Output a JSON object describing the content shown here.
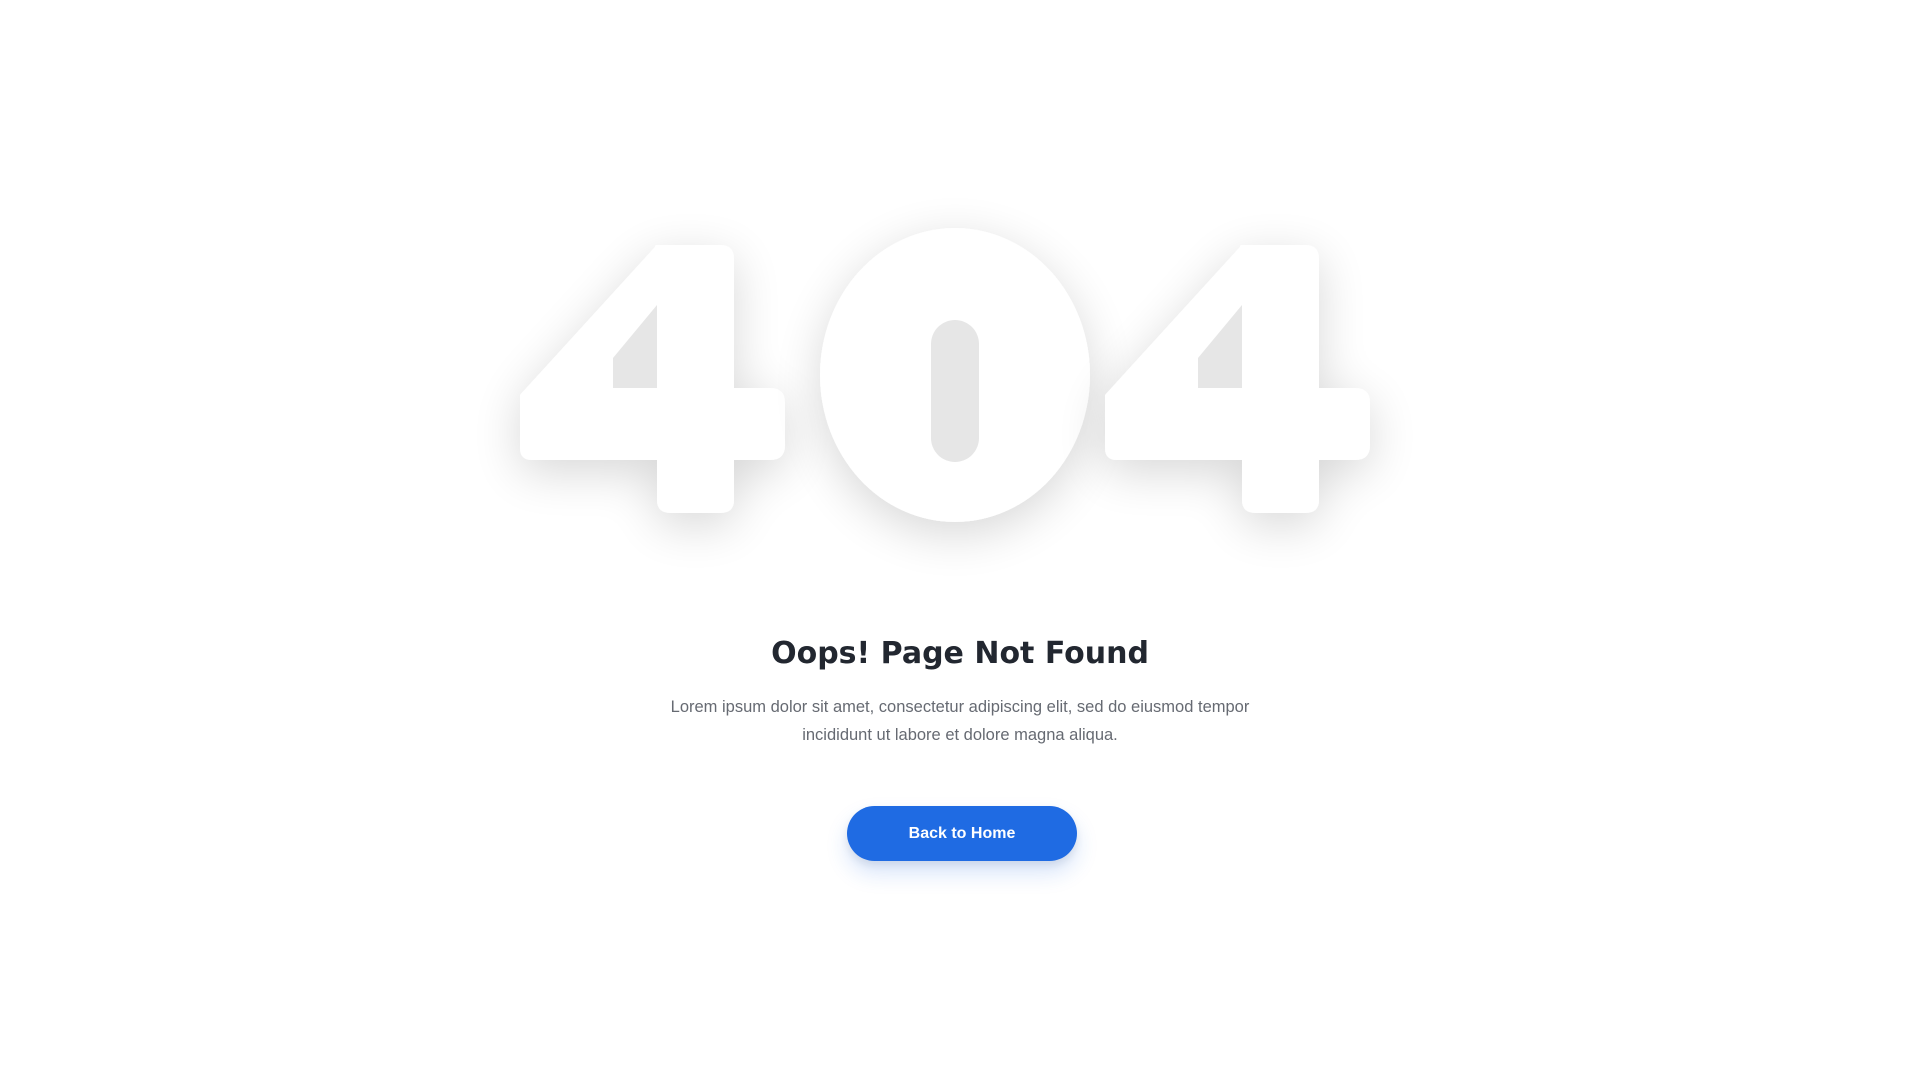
{
  "error": {
    "code": "404",
    "digits": [
      "4",
      "0",
      "4"
    ]
  },
  "title": "Oops! Page Not Found",
  "description_line1": "Lorem ipsum dolor sit amet, consectetur adipiscing elit, sed do eiusmod tempor",
  "description_line2": "incididunt ut labore et dolore magna aliqua.",
  "button": {
    "label": "Back to Home"
  },
  "colors": {
    "background": "#ffffff",
    "title": "#222730",
    "text": "#666a72",
    "accent": "#1f6be3",
    "digit": "#ffffff",
    "digit_inner": "#e6e6e6"
  }
}
